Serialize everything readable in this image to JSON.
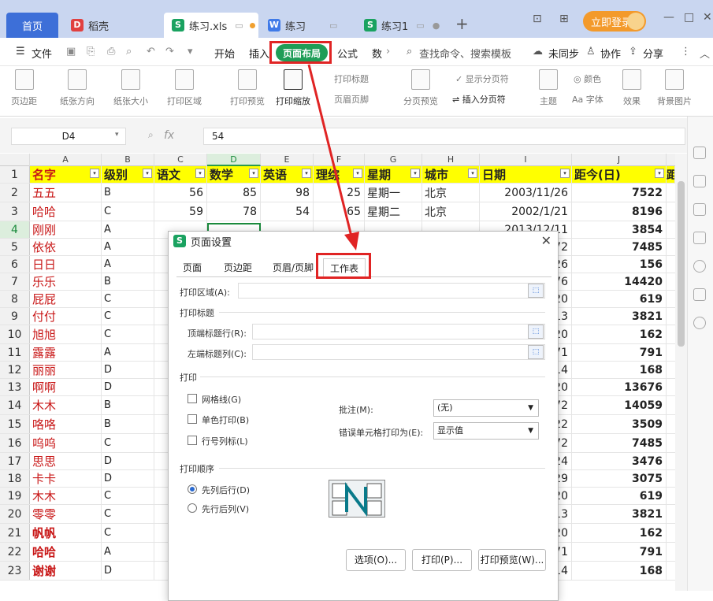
{
  "titlebar": {
    "tabs": [
      {
        "label": "首页"
      },
      {
        "label": "稻壳"
      },
      {
        "label": "练习.xls"
      },
      {
        "label": "练习"
      },
      {
        "label": "练习1"
      }
    ],
    "login_label": "立即登录"
  },
  "menu": {
    "file": "文件",
    "items": [
      "开始",
      "插入",
      "页面布局",
      "公式",
      "数"
    ],
    "search": "查找命令、搜索模板",
    "sync": "未同步",
    "collab": "协作",
    "share": "分享"
  },
  "toolbar": {
    "buttons": [
      "页边距",
      "纸张方向",
      "纸张大小",
      "打印区域",
      "打印预览",
      "打印缩放",
      "分页预览",
      "主题",
      "字体",
      "效果",
      "背景图片"
    ],
    "print_title": "打印标题",
    "header_footer": "页眉页脚",
    "show_pagebreak": "显示分页符",
    "insert_pagebreak": "插入分页符",
    "color": "颜色"
  },
  "formula": {
    "cell": "D4",
    "fx": "fx",
    "value": "54"
  },
  "columns": [
    "A",
    "B",
    "C",
    "D",
    "E",
    "F",
    "G",
    "H",
    "I",
    "J"
  ],
  "header": {
    "name": "名字",
    "level": "级别",
    "chinese": "语文",
    "math": "数学",
    "english": "英语",
    "science": "理综",
    "weekday": "星期",
    "city": "城市",
    "date": "日期",
    "days": "距今(日)",
    "extra": "距"
  },
  "rows": [
    {
      "n": "2",
      "name": "五五",
      "lvl": "B",
      "yw": "56",
      "sx": "85",
      "yy": "98",
      "lz": "25",
      "xq": "星期一",
      "cs": "北京",
      "rq": "2003/11/26",
      "jj": "7522"
    },
    {
      "n": "3",
      "name": "哈哈",
      "lvl": "C",
      "yw": "59",
      "sx": "78",
      "yy": "54",
      "lz": "65",
      "xq": "星期二",
      "cs": "北京",
      "rq": "2002/1/21",
      "jj": "8196"
    },
    {
      "n": "4",
      "name": "刚刚",
      "lvl": "A",
      "yw": "",
      "sx": "",
      "yy": "",
      "lz": "",
      "xq": "",
      "cs": "",
      "rq": "2013/12/11",
      "jj": "3854"
    },
    {
      "n": "5",
      "name": "依依",
      "lvl": "A",
      "rq": "72",
      "jj": "7485"
    },
    {
      "n": "6",
      "name": "日日",
      "lvl": "A",
      "rq": "26",
      "jj": "156"
    },
    {
      "n": "7",
      "name": "乐乐",
      "lvl": "B",
      "rq": "76",
      "jj": "14420"
    },
    {
      "n": "8",
      "name": "屁屁",
      "lvl": "C",
      "rq": "20",
      "jj": "619"
    },
    {
      "n": "9",
      "name": "付付",
      "lvl": "C",
      "rq": "13",
      "jj": "3821"
    },
    {
      "n": "10",
      "name": "旭旭",
      "lvl": "C",
      "rq": "20",
      "jj": "162"
    },
    {
      "n": "11",
      "name": "露露",
      "lvl": "A",
      "rq": "71",
      "jj": "791"
    },
    {
      "n": "12",
      "name": "丽丽",
      "lvl": "D",
      "rq": "14",
      "jj": "168"
    },
    {
      "n": "13",
      "name": "啊啊",
      "lvl": "D",
      "rq": "20",
      "jj": "13676"
    },
    {
      "n": "14",
      "name": "木木",
      "lvl": "B",
      "rq": "72",
      "jj": "14059"
    },
    {
      "n": "15",
      "name": "咯咯",
      "lvl": "B",
      "rq": "22",
      "jj": "3509"
    },
    {
      "n": "16",
      "name": "呜呜",
      "lvl": "C",
      "rq": "72",
      "jj": "7485"
    },
    {
      "n": "17",
      "name": "思思",
      "lvl": "D",
      "rq": "24",
      "jj": "3476"
    },
    {
      "n": "18",
      "name": "卡卡",
      "lvl": "D",
      "rq": "29",
      "jj": "3075"
    },
    {
      "n": "19",
      "name": "木木",
      "lvl": "C",
      "rq": "20",
      "jj": "619"
    },
    {
      "n": "20",
      "name": "零零",
      "lvl": "C",
      "rq": "13",
      "jj": "3821"
    },
    {
      "n": "21",
      "name": "帆帆",
      "lvl": "C",
      "rq": "20",
      "jj": "162"
    },
    {
      "n": "22",
      "name": "哈哈",
      "lvl": "A",
      "rq": "71",
      "jj": "791"
    },
    {
      "n": "23",
      "name": "谢谢",
      "lvl": "D",
      "rq": "14",
      "jj": "168"
    }
  ],
  "dialog": {
    "title": "页面设置",
    "tabs": [
      "页面",
      "页边距",
      "页眉/页脚",
      "工作表"
    ],
    "print_area": "打印区域(A):",
    "print_title_section": "打印标题",
    "top_rows": "顶端标题行(R):",
    "left_cols": "左端标题列(C):",
    "print_section": "打印",
    "gridlines": "网格线(G)",
    "mono": "单色打印(B)",
    "rowcol": "行号列标(L)",
    "comments_label": "批注(M):",
    "comments_value": "(无)",
    "errors_label": "错误单元格打印为(E):",
    "errors_value": "显示值",
    "order_section": "打印顺序",
    "down_then_over": "先列后行(D)",
    "over_then_down": "先行后列(V)",
    "options_btn": "选项(O)...",
    "print_btn": "打印(P)...",
    "preview_btn": "打印预览(W)..."
  }
}
